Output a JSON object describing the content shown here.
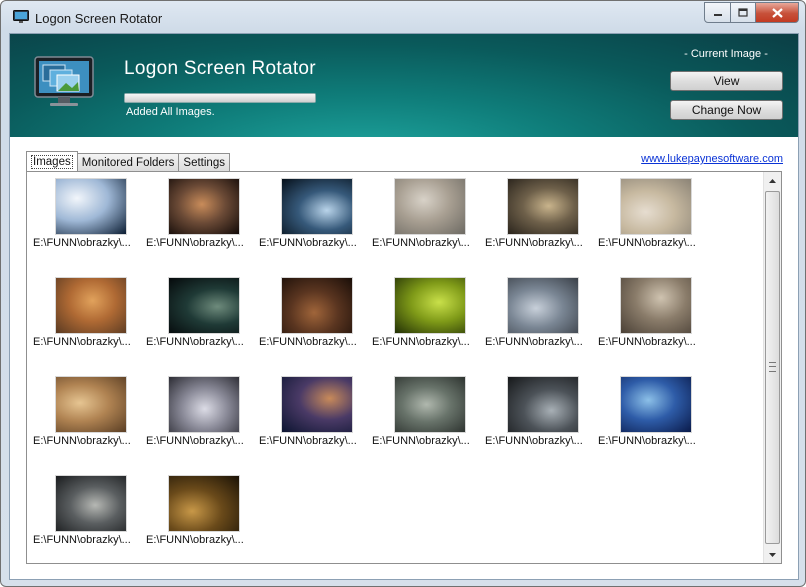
{
  "window": {
    "title": "Logon Screen Rotator"
  },
  "header": {
    "app_title": "Logon Screen Rotator",
    "progress": 1.0,
    "status": "Added All Images.",
    "current_image_label": "- Current Image -",
    "view_label": "View",
    "change_now_label": "Change Now"
  },
  "tabs": [
    {
      "label": "Images",
      "active": true
    },
    {
      "label": "Monitored Folders",
      "active": false
    },
    {
      "label": "Settings",
      "active": false
    }
  ],
  "site_link": "www.lukepaynesoftware.com",
  "images": [
    {
      "caption": "E:\\FUNN\\obrazky\\...",
      "colors": [
        "#0b1d33",
        "#9fb8d6",
        "#f2f6fb"
      ]
    },
    {
      "caption": "E:\\FUNN\\obrazky\\...",
      "colors": [
        "#120a08",
        "#6b4a36",
        "#c98c5a"
      ]
    },
    {
      "caption": "E:\\FUNN\\obrazky\\...",
      "colors": [
        "#06101a",
        "#36597a",
        "#b9d4ea"
      ]
    },
    {
      "caption": "E:\\FUNN\\obrazky\\...",
      "colors": [
        "#6d6a63",
        "#a89f92",
        "#d8d2c8"
      ]
    },
    {
      "caption": "E:\\FUNN\\obrazky\\...",
      "colors": [
        "#2a241c",
        "#6e604a",
        "#c9b48c"
      ]
    },
    {
      "caption": "E:\\FUNN\\obrazky\\...",
      "colors": [
        "#8b8376",
        "#c7b9a0",
        "#e6ddd0"
      ]
    },
    {
      "caption": "E:\\FUNN\\obrazky\\...",
      "colors": [
        "#5a3a22",
        "#b06a34",
        "#e1a25c"
      ]
    },
    {
      "caption": "E:\\FUNN\\obrazky\\...",
      "colors": [
        "#05090b",
        "#1f3a36",
        "#6e8b7c"
      ]
    },
    {
      "caption": "E:\\FUNN\\obrazky\\...",
      "colors": [
        "#1a0e08",
        "#5a3520",
        "#a0653a"
      ]
    },
    {
      "caption": "E:\\FUNN\\obrazky\\...",
      "colors": [
        "#223006",
        "#7f9a18",
        "#c9e04a"
      ]
    },
    {
      "caption": "E:\\FUNN\\obrazky\\...",
      "colors": [
        "#3a4048",
        "#7a8694",
        "#c8d0da"
      ]
    },
    {
      "caption": "E:\\FUNN\\obrazky\\...",
      "colors": [
        "#4a4036",
        "#8a7c6a",
        "#cfc3b0"
      ]
    },
    {
      "caption": "E:\\FUNN\\obrazky\\...",
      "colors": [
        "#5a3e24",
        "#b08352",
        "#e6c592"
      ]
    },
    {
      "caption": "E:\\FUNN\\obrazky\\...",
      "colors": [
        "#2c2c34",
        "#8a8a98",
        "#dcdce6"
      ]
    },
    {
      "caption": "E:\\FUNN\\obrazky\\...",
      "colors": [
        "#0b1430",
        "#4a3a66",
        "#c88a5a"
      ]
    },
    {
      "caption": "E:\\FUNN\\obrazky\\...",
      "colors": [
        "#2e3430",
        "#68736a",
        "#b0b8ae"
      ]
    },
    {
      "caption": "E:\\FUNN\\obrazky\\...",
      "colors": [
        "#16181a",
        "#4c5258",
        "#a8b0b6"
      ]
    },
    {
      "caption": "E:\\FUNN\\obrazky\\...",
      "colors": [
        "#0a1a4a",
        "#2e5ca8",
        "#8cc0e8"
      ]
    },
    {
      "caption": "E:\\FUNN\\obrazky\\...",
      "colors": [
        "#1a1c1e",
        "#5a5e60",
        "#b6b8b4"
      ]
    },
    {
      "caption": "E:\\FUNN\\obrazky\\...",
      "colors": [
        "#1a1206",
        "#6a4a1a",
        "#c89848"
      ]
    }
  ],
  "colors": {
    "banner_teal": "#0f7d7a",
    "link_blue": "#0a33d6",
    "close_red": "#c7513a"
  },
  "icons": {
    "app": "monitor-icon",
    "minimize": "minimize-icon",
    "maximize": "maximize-icon",
    "close": "close-icon",
    "scroll_up": "chevron-up-icon",
    "scroll_down": "chevron-down-icon"
  }
}
